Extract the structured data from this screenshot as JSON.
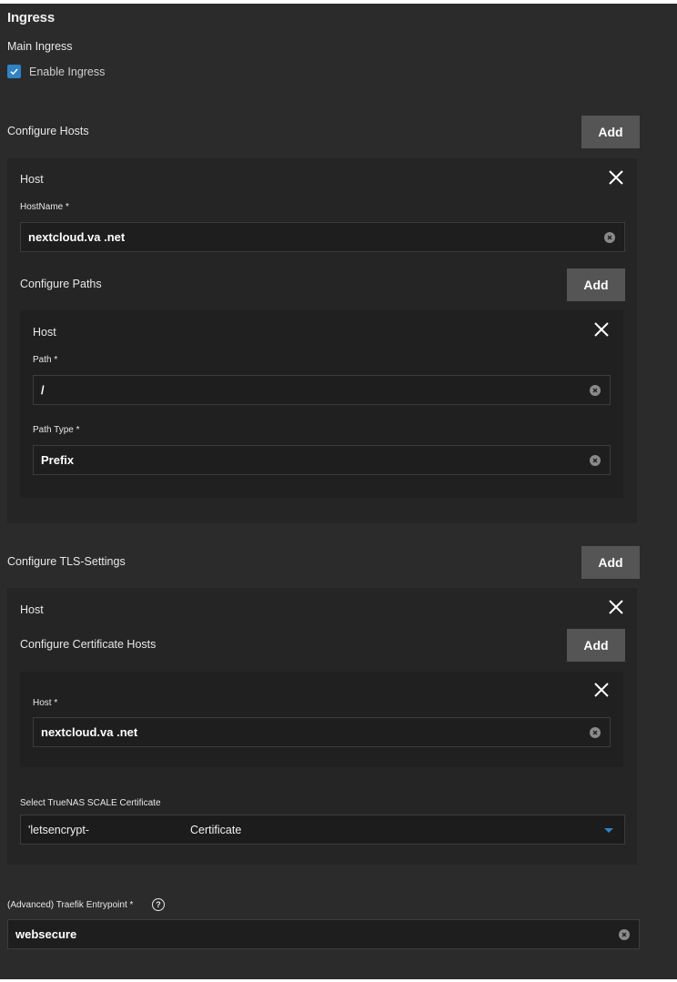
{
  "section": {
    "title": "Ingress",
    "main_ingress": "Main Ingress",
    "enable_ingress_label": "Enable Ingress",
    "enable_ingress_checked": true
  },
  "hosts": {
    "heading": "Configure Hosts",
    "add_label": "Add",
    "card_title": "Host",
    "hostname_label": "HostName *",
    "hostname_value": "nextcloud.va .net",
    "paths": {
      "heading": "Configure Paths",
      "add_label": "Add",
      "card_title": "Host",
      "path_label": "Path *",
      "path_value": "/",
      "path_type_label": "Path Type *",
      "path_type_value": "Prefix"
    }
  },
  "tls": {
    "heading": "Configure TLS-Settings",
    "add_label": "Add",
    "card_title": "Host",
    "cert_hosts": {
      "heading": "Configure Certificate Hosts",
      "add_label": "Add",
      "host_label": "Host *",
      "host_value": "nextcloud.va .net"
    },
    "certificate_label": "Select TrueNAS SCALE Certificate",
    "certificate_value_left": "'letsencrypt-",
    "certificate_value_right": "Certificate"
  },
  "traefik": {
    "label": "(Advanced) Traefik Entrypoint *",
    "help_icon_glyph": "?",
    "value": "websecure"
  },
  "icons": {
    "close": "close-icon",
    "clear": "clear-circle-icon",
    "dropdown": "caret-down-icon",
    "check": "check-icon",
    "help": "help-circle-icon"
  },
  "colors": {
    "accent": "#2f83c6",
    "background": "#2b2b2b",
    "button": "#555555"
  }
}
